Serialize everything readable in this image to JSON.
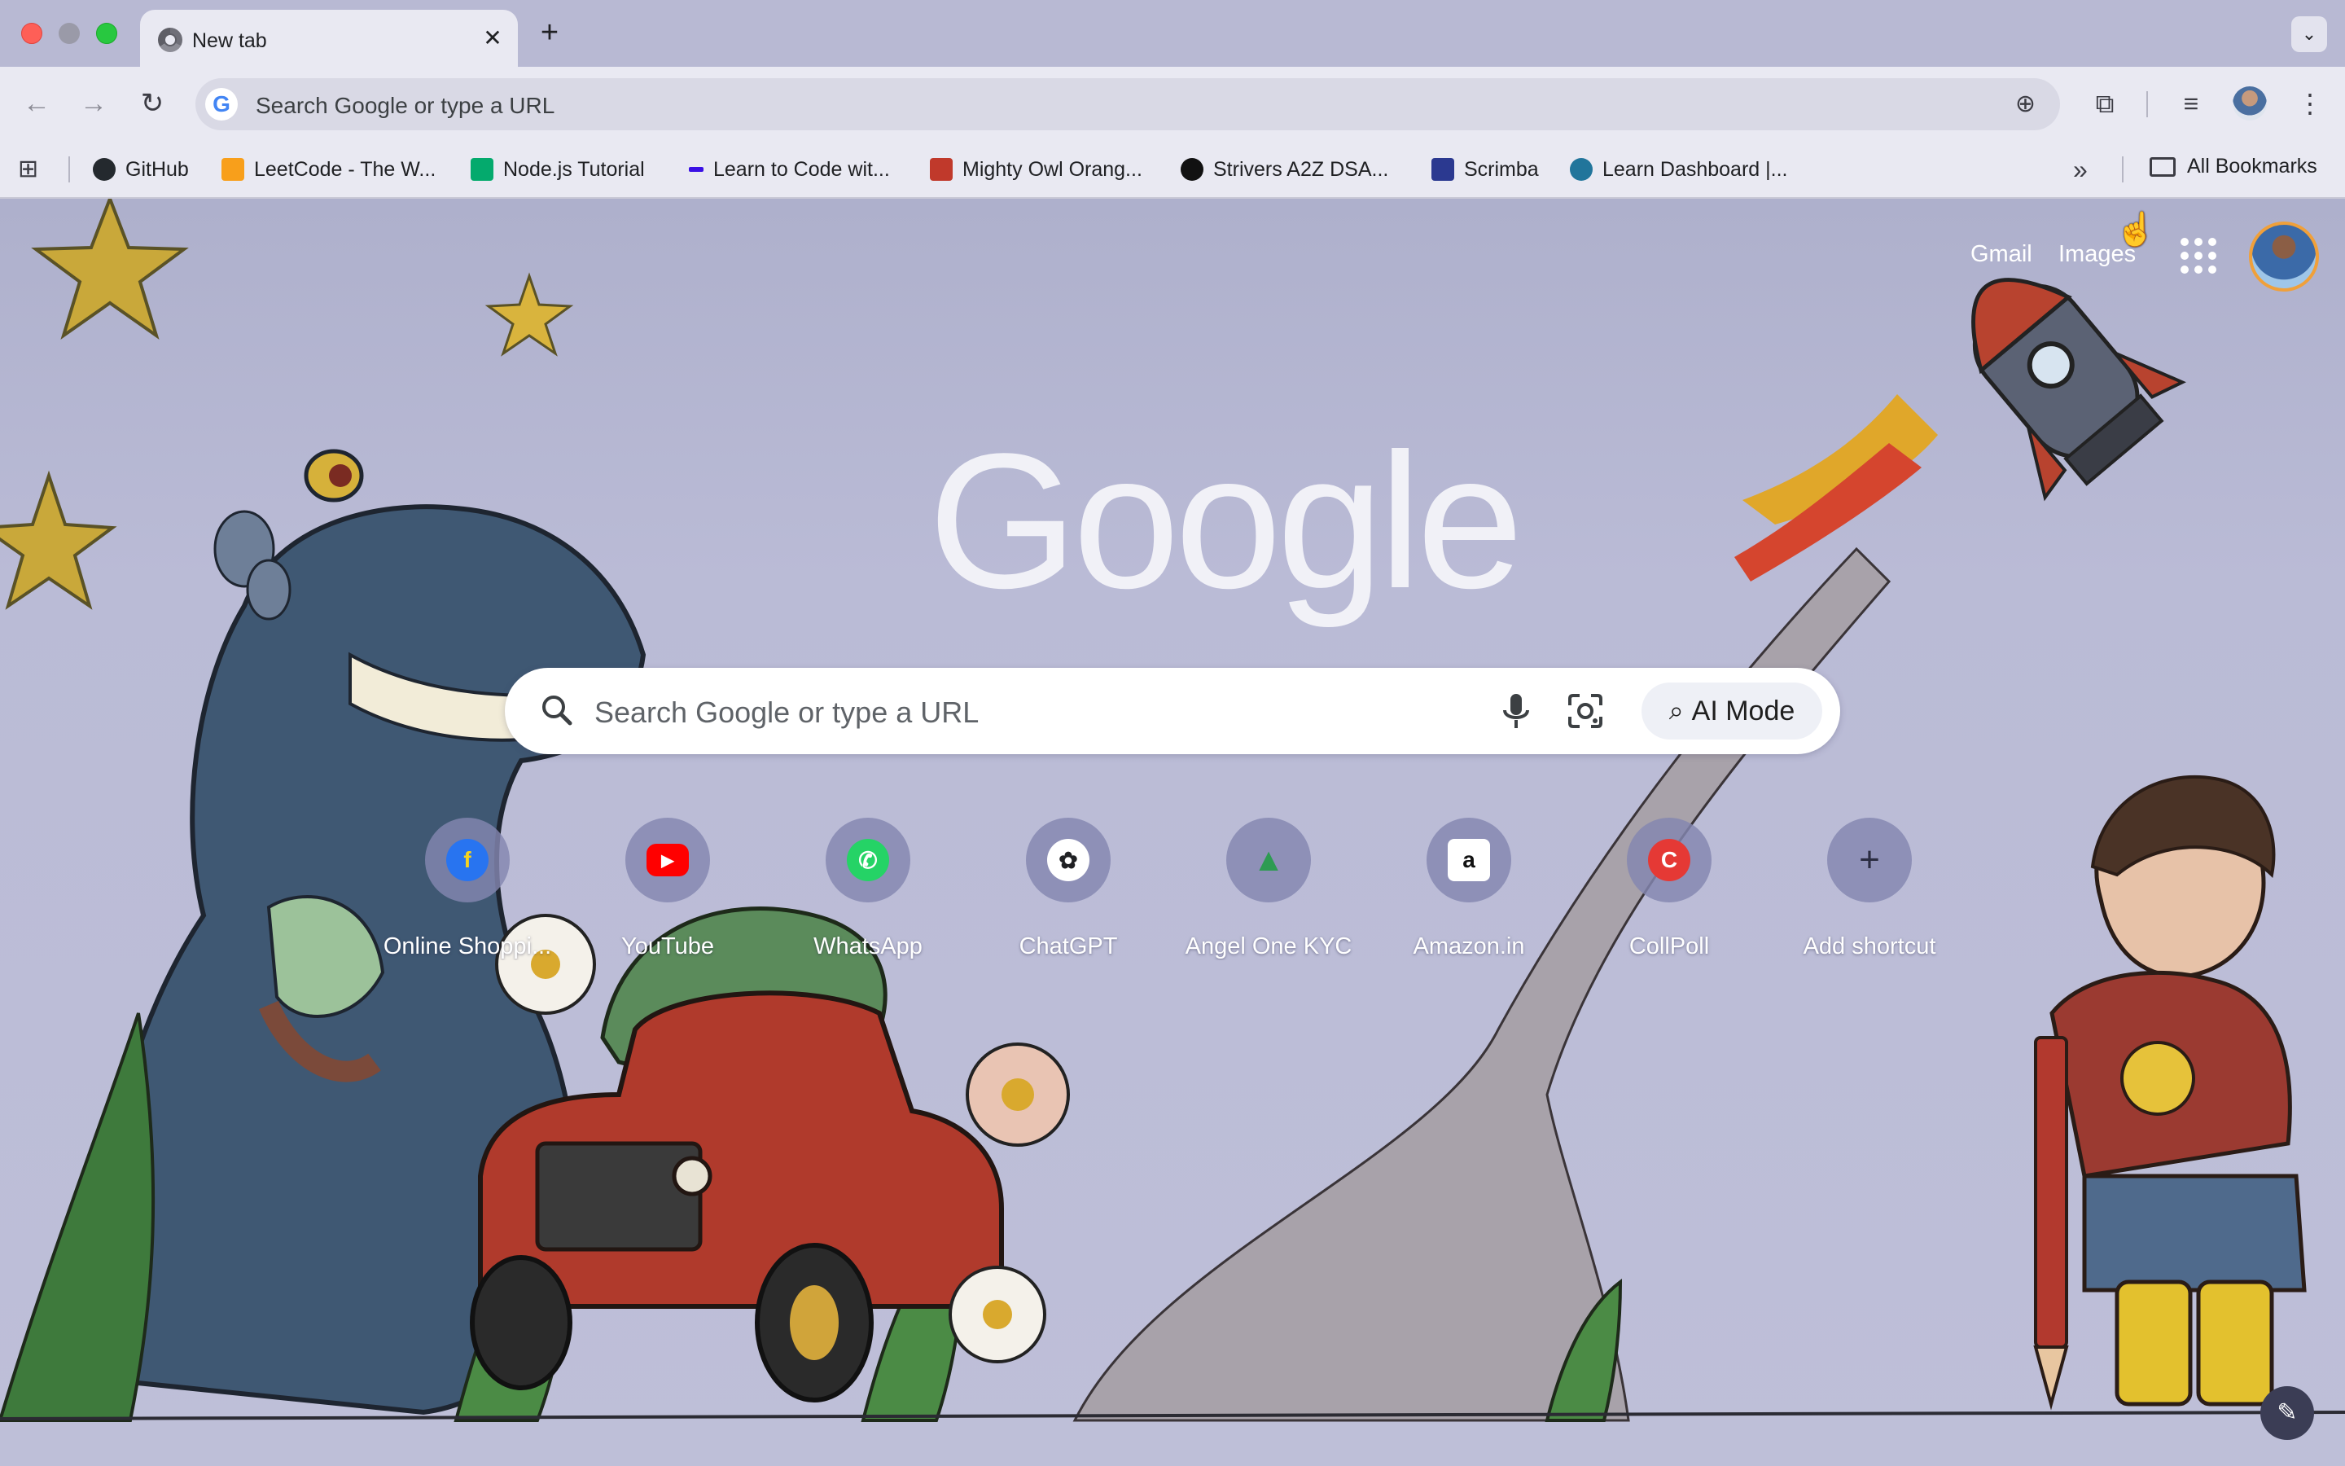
{
  "window": {
    "tab_title": "New tab",
    "tab_close_glyph": "✕",
    "new_tab_glyph": "+",
    "tab_search_glyph": "⌄"
  },
  "toolbar": {
    "back_glyph": "←",
    "forward_glyph": "→",
    "reload_glyph": "↻",
    "omnibox_placeholder": "Search Google or type a URL",
    "omnibox_g": "G",
    "zoom_glyph": "⊕",
    "extensions_glyph": "⧉",
    "media_glyph": "≡",
    "menu_glyph": "⋮"
  },
  "bookmarks": {
    "apps_glyph": "⊞",
    "items": [
      {
        "label": "GitHub",
        "icon": "github-icon",
        "color": "#24292e"
      },
      {
        "label": "LeetCode - The W...",
        "icon": "leetcode-icon",
        "color": "#f89f1b"
      },
      {
        "label": "Node.js Tutorial",
        "icon": "w3schools-icon",
        "color": "#04aa6d"
      },
      {
        "label": "Learn to Code wit...",
        "icon": "codecademy-icon",
        "color": "#3a10e5"
      },
      {
        "label": "Mighty Owl Orang...",
        "icon": "shop-icon",
        "color": "#c0392b"
      },
      {
        "label": "Strivers A2Z DSA...",
        "icon": "tuf-icon",
        "color": "#111111"
      },
      {
        "label": "Scrimba",
        "icon": "scrimba-icon",
        "color": "#2b3990"
      },
      {
        "label": "Learn Dashboard |...",
        "icon": "wordpress-icon",
        "color": "#21759b"
      }
    ],
    "overflow_glyph": "»",
    "all_bookmarks": "All Bookmarks"
  },
  "ntp": {
    "gmail": "Gmail",
    "images": "Images",
    "logo": "Google",
    "search_placeholder": "Search Google or type a URL",
    "ai_mode": "AI Mode",
    "shortcuts": [
      {
        "label": "Online Shoppi...",
        "icon": "flipkart-icon",
        "color": "#2874f0",
        "glyph": "f"
      },
      {
        "label": "YouTube",
        "icon": "youtube-icon",
        "color": "#ff0000",
        "glyph": "▶"
      },
      {
        "label": "WhatsApp",
        "icon": "whatsapp-icon",
        "color": "#25d366",
        "glyph": "✆"
      },
      {
        "label": "ChatGPT",
        "icon": "chatgpt-icon",
        "color": "#ffffff",
        "glyph": "✿"
      },
      {
        "label": "Angel One KYC",
        "icon": "angelone-icon",
        "color": "#2d9b52",
        "glyph": "▲"
      },
      {
        "label": "Amazon.in",
        "icon": "amazon-icon",
        "color": "#ffffff",
        "glyph": "a"
      },
      {
        "label": "CollPoll",
        "icon": "collpoll-icon",
        "color": "#e53935",
        "glyph": "C"
      },
      {
        "label": "Add shortcut",
        "icon": "plus-icon",
        "color": "transparent",
        "glyph": "+"
      }
    ],
    "customize_glyph": "✎"
  }
}
